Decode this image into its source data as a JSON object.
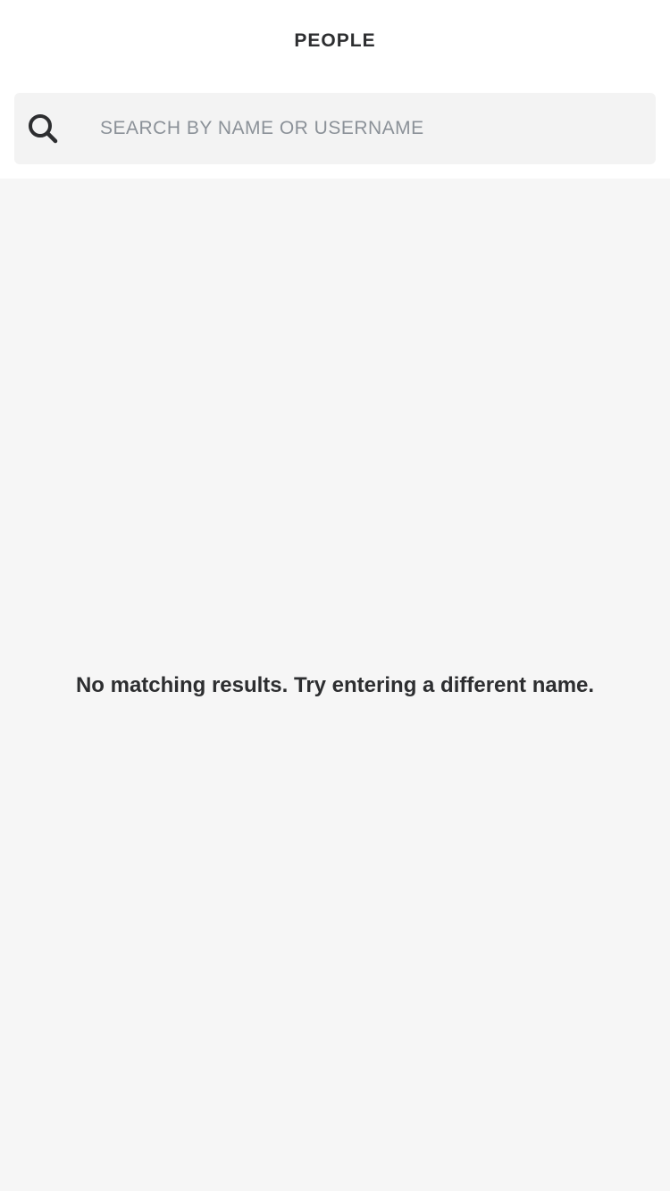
{
  "header": {
    "title": "PEOPLE"
  },
  "search": {
    "icon": "search-icon",
    "placeholder": "SEARCH BY NAME OR USERNAME",
    "value": ""
  },
  "results": {
    "empty_message": "No matching results. Try entering a different name."
  },
  "colors": {
    "header_background": "#ffffff",
    "search_background": "#f3f3f3",
    "results_background": "#f6f6f6",
    "text_primary": "#2d2e30",
    "placeholder_text": "#8b9198"
  }
}
